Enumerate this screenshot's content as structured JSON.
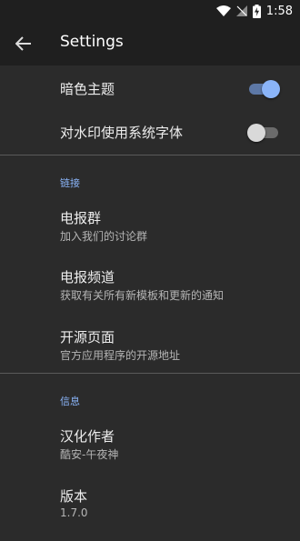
{
  "status": {
    "time": "1:58"
  },
  "appbar": {
    "title": "Settings"
  },
  "switches": [
    {
      "label": "暗色主题",
      "on": true
    },
    {
      "label": "对水印使用系统字体",
      "on": false
    }
  ],
  "links": {
    "section": "链接",
    "items": [
      {
        "title": "电报群",
        "subtitle": "加入我们的讨论群"
      },
      {
        "title": "电报频道",
        "subtitle": "获取有关所有新模板和更新的通知"
      },
      {
        "title": "开源页面",
        "subtitle": "官方应用程序的开源地址"
      }
    ]
  },
  "info": {
    "section": "信息",
    "items": [
      {
        "title": "汉化作者",
        "subtitle": "酷安-午夜神"
      },
      {
        "title": "版本",
        "subtitle": "1.7.0"
      }
    ]
  }
}
